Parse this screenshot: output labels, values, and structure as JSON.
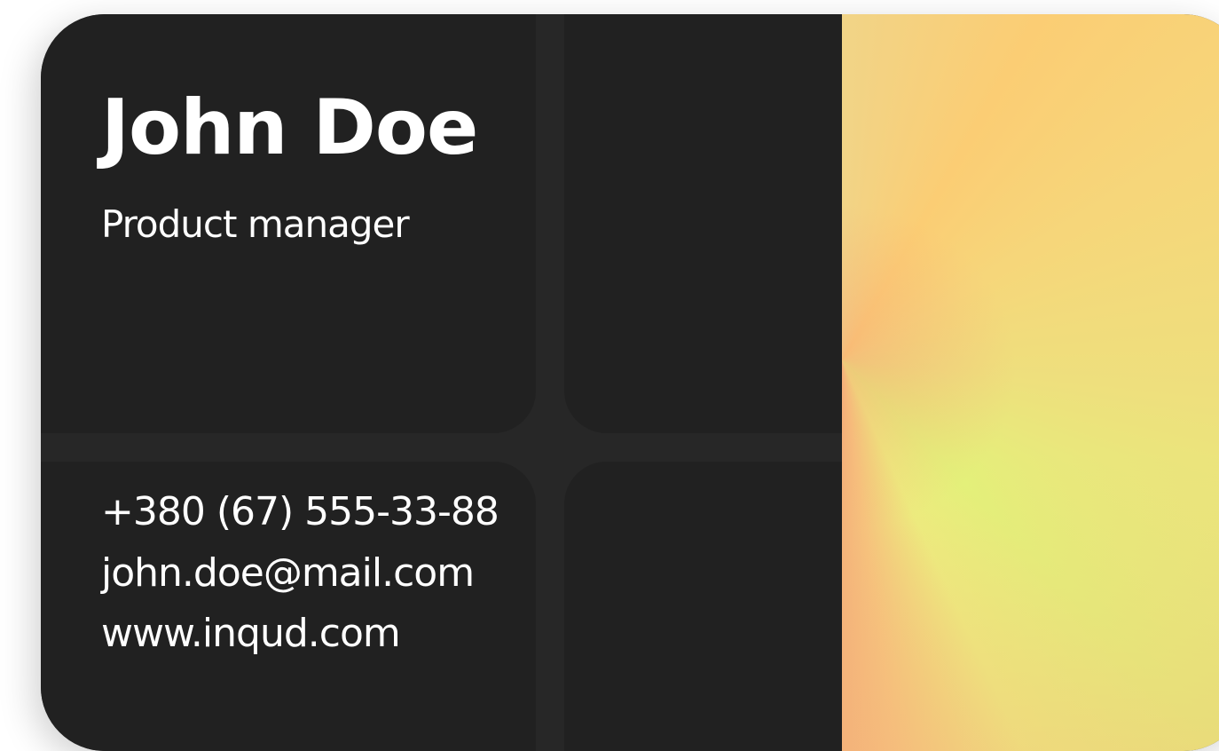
{
  "card": {
    "name": "John Doe",
    "title": "Product manager",
    "phone": "+380 (67) 555-33-88",
    "email": "john.doe@mail.com",
    "website": "www.inqud.com"
  },
  "colors": {
    "background": "#ffffff",
    "card_dark": "#272727",
    "panel_dark": "#212121",
    "text": "#ffffff",
    "holo_yellow": "#fbcd74",
    "holo_lime": "#e3f27a",
    "holo_peach": "#f4b37a"
  }
}
